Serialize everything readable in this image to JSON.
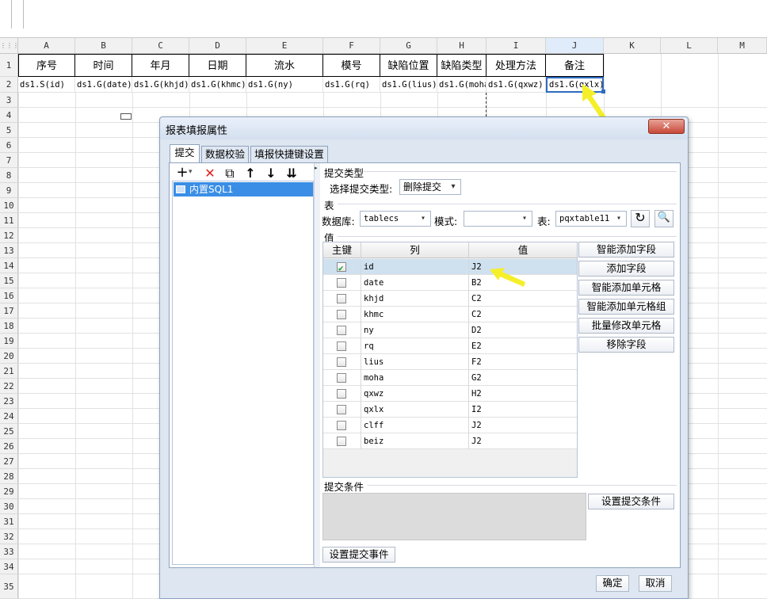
{
  "columns": [
    "A",
    "B",
    "C",
    "D",
    "E",
    "F",
    "G",
    "H",
    "I",
    "J",
    "K",
    "L",
    "M"
  ],
  "rows": [
    "1",
    "2",
    "3",
    "4",
    "5",
    "6",
    "7",
    "8",
    "9",
    "10",
    "11",
    "12",
    "13",
    "14",
    "15",
    "16",
    "17",
    "18",
    "19",
    "20",
    "21",
    "22",
    "23",
    "24",
    "25",
    "26",
    "27",
    "28",
    "29",
    "30",
    "31",
    "32",
    "33",
    "34",
    "35"
  ],
  "header_row": [
    "序号",
    "时间",
    "年月",
    "日期",
    "流水",
    "模号",
    "缺陷位置",
    "缺陷类型",
    "处理方法",
    "备注"
  ],
  "formula_row": [
    "ds1.S(id)",
    "ds1.G(date)",
    "ds1.G(khjd)",
    "ds1.G(khmc)",
    "ds1.G(ny)",
    "ds1.G(rq)",
    "ds1.G(lius)",
    "ds1.G(moha",
    "ds1.G(qxwz)",
    "ds1.G(qxlx)"
  ],
  "dialog": {
    "title": "报表填报属性",
    "close": "✕",
    "tabs": [
      "提交",
      "数据校验",
      "填报快捷键设置"
    ],
    "toolbar": {
      "add": "+",
      "add_arrow": "▾",
      "delete": "✕",
      "copy": "⧉",
      "up": "↑",
      "down": "↓",
      "bottom": "⇊"
    },
    "tree_item": "内置SQL1",
    "submit_type": {
      "section": "提交类型",
      "label": "选择提交类型:",
      "value": "删除提交"
    },
    "table": {
      "section": "表",
      "db_label": "数据库:",
      "db_value": "tablecs",
      "mode_label": "模式:",
      "mode_value": "",
      "table_label": "表:",
      "table_value": "pqxtable11"
    },
    "value": {
      "section": "值",
      "headers": [
        "主键",
        "列",
        "值"
      ],
      "rows": [
        {
          "key": true,
          "col": "id",
          "val": "J2"
        },
        {
          "key": false,
          "col": "date",
          "val": "B2"
        },
        {
          "key": false,
          "col": "khjd",
          "val": "C2"
        },
        {
          "key": false,
          "col": "khmc",
          "val": "C2"
        },
        {
          "key": false,
          "col": "ny",
          "val": "D2"
        },
        {
          "key": false,
          "col": "rq",
          "val": "E2"
        },
        {
          "key": false,
          "col": "lius",
          "val": "F2"
        },
        {
          "key": false,
          "col": "moha",
          "val": "G2"
        },
        {
          "key": false,
          "col": "qxwz",
          "val": "H2"
        },
        {
          "key": false,
          "col": "qxlx",
          "val": "I2"
        },
        {
          "key": false,
          "col": "clff",
          "val": "J2"
        },
        {
          "key": false,
          "col": "beiz",
          "val": "J2"
        }
      ]
    },
    "side_buttons": [
      "智能添加字段",
      "添加字段",
      "智能添加单元格",
      "智能添加单元格组",
      "批量修改单元格",
      "移除字段"
    ],
    "condition": {
      "section": "提交条件",
      "set_button": "设置提交条件"
    },
    "event_button": "设置提交事件",
    "ok": "确定",
    "cancel": "取消"
  },
  "colors": {
    "selection": "#2d6cc0",
    "tree_selected": "#3a8ee6",
    "arrow": "#f5ef2a",
    "close": "#c7493a"
  }
}
